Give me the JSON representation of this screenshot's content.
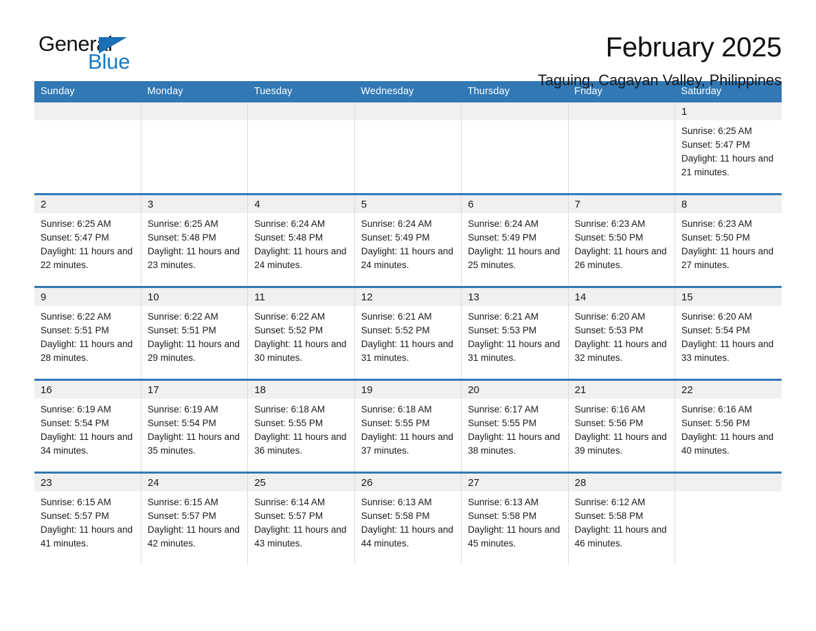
{
  "brand": {
    "word_one": "General",
    "word_two": "Blue",
    "triangle_icon": "triangle-icon",
    "accent_color": "#1a7bc4"
  },
  "header": {
    "title": "February 2025",
    "subtitle": "Taguing, Cagayan Valley, Philippines"
  },
  "theme": {
    "header_bar": "#3178b5",
    "date_band": "#f0f0f0",
    "cell_bg": "#ffffff",
    "text": "#1a1a1a"
  },
  "weekday_headers": [
    "Sunday",
    "Monday",
    "Tuesday",
    "Wednesday",
    "Thursday",
    "Friday",
    "Saturday"
  ],
  "weeks": [
    [
      {
        "day": "",
        "sunrise": "",
        "sunset": "",
        "daylight": "",
        "blank": true
      },
      {
        "day": "",
        "sunrise": "",
        "sunset": "",
        "daylight": "",
        "blank": true
      },
      {
        "day": "",
        "sunrise": "",
        "sunset": "",
        "daylight": "",
        "blank": true
      },
      {
        "day": "",
        "sunrise": "",
        "sunset": "",
        "daylight": "",
        "blank": true
      },
      {
        "day": "",
        "sunrise": "",
        "sunset": "",
        "daylight": "",
        "blank": true
      },
      {
        "day": "",
        "sunrise": "",
        "sunset": "",
        "daylight": "",
        "blank": true
      },
      {
        "day": "1",
        "sunrise": "Sunrise: 6:25 AM",
        "sunset": "Sunset: 5:47 PM",
        "daylight": "Daylight: 11 hours and 21 minutes.",
        "blank": false
      }
    ],
    [
      {
        "day": "2",
        "sunrise": "Sunrise: 6:25 AM",
        "sunset": "Sunset: 5:47 PM",
        "daylight": "Daylight: 11 hours and 22 minutes.",
        "blank": false
      },
      {
        "day": "3",
        "sunrise": "Sunrise: 6:25 AM",
        "sunset": "Sunset: 5:48 PM",
        "daylight": "Daylight: 11 hours and 23 minutes.",
        "blank": false
      },
      {
        "day": "4",
        "sunrise": "Sunrise: 6:24 AM",
        "sunset": "Sunset: 5:48 PM",
        "daylight": "Daylight: 11 hours and 24 minutes.",
        "blank": false
      },
      {
        "day": "5",
        "sunrise": "Sunrise: 6:24 AM",
        "sunset": "Sunset: 5:49 PM",
        "daylight": "Daylight: 11 hours and 24 minutes.",
        "blank": false
      },
      {
        "day": "6",
        "sunrise": "Sunrise: 6:24 AM",
        "sunset": "Sunset: 5:49 PM",
        "daylight": "Daylight: 11 hours and 25 minutes.",
        "blank": false
      },
      {
        "day": "7",
        "sunrise": "Sunrise: 6:23 AM",
        "sunset": "Sunset: 5:50 PM",
        "daylight": "Daylight: 11 hours and 26 minutes.",
        "blank": false
      },
      {
        "day": "8",
        "sunrise": "Sunrise: 6:23 AM",
        "sunset": "Sunset: 5:50 PM",
        "daylight": "Daylight: 11 hours and 27 minutes.",
        "blank": false
      }
    ],
    [
      {
        "day": "9",
        "sunrise": "Sunrise: 6:22 AM",
        "sunset": "Sunset: 5:51 PM",
        "daylight": "Daylight: 11 hours and 28 minutes.",
        "blank": false
      },
      {
        "day": "10",
        "sunrise": "Sunrise: 6:22 AM",
        "sunset": "Sunset: 5:51 PM",
        "daylight": "Daylight: 11 hours and 29 minutes.",
        "blank": false
      },
      {
        "day": "11",
        "sunrise": "Sunrise: 6:22 AM",
        "sunset": "Sunset: 5:52 PM",
        "daylight": "Daylight: 11 hours and 30 minutes.",
        "blank": false
      },
      {
        "day": "12",
        "sunrise": "Sunrise: 6:21 AM",
        "sunset": "Sunset: 5:52 PM",
        "daylight": "Daylight: 11 hours and 31 minutes.",
        "blank": false
      },
      {
        "day": "13",
        "sunrise": "Sunrise: 6:21 AM",
        "sunset": "Sunset: 5:53 PM",
        "daylight": "Daylight: 11 hours and 31 minutes.",
        "blank": false
      },
      {
        "day": "14",
        "sunrise": "Sunrise: 6:20 AM",
        "sunset": "Sunset: 5:53 PM",
        "daylight": "Daylight: 11 hours and 32 minutes.",
        "blank": false
      },
      {
        "day": "15",
        "sunrise": "Sunrise: 6:20 AM",
        "sunset": "Sunset: 5:54 PM",
        "daylight": "Daylight: 11 hours and 33 minutes.",
        "blank": false
      }
    ],
    [
      {
        "day": "16",
        "sunrise": "Sunrise: 6:19 AM",
        "sunset": "Sunset: 5:54 PM",
        "daylight": "Daylight: 11 hours and 34 minutes.",
        "blank": false
      },
      {
        "day": "17",
        "sunrise": "Sunrise: 6:19 AM",
        "sunset": "Sunset: 5:54 PM",
        "daylight": "Daylight: 11 hours and 35 minutes.",
        "blank": false
      },
      {
        "day": "18",
        "sunrise": "Sunrise: 6:18 AM",
        "sunset": "Sunset: 5:55 PM",
        "daylight": "Daylight: 11 hours and 36 minutes.",
        "blank": false
      },
      {
        "day": "19",
        "sunrise": "Sunrise: 6:18 AM",
        "sunset": "Sunset: 5:55 PM",
        "daylight": "Daylight: 11 hours and 37 minutes.",
        "blank": false
      },
      {
        "day": "20",
        "sunrise": "Sunrise: 6:17 AM",
        "sunset": "Sunset: 5:55 PM",
        "daylight": "Daylight: 11 hours and 38 minutes.",
        "blank": false
      },
      {
        "day": "21",
        "sunrise": "Sunrise: 6:16 AM",
        "sunset": "Sunset: 5:56 PM",
        "daylight": "Daylight: 11 hours and 39 minutes.",
        "blank": false
      },
      {
        "day": "22",
        "sunrise": "Sunrise: 6:16 AM",
        "sunset": "Sunset: 5:56 PM",
        "daylight": "Daylight: 11 hours and 40 minutes.",
        "blank": false
      }
    ],
    [
      {
        "day": "23",
        "sunrise": "Sunrise: 6:15 AM",
        "sunset": "Sunset: 5:57 PM",
        "daylight": "Daylight: 11 hours and 41 minutes.",
        "blank": false
      },
      {
        "day": "24",
        "sunrise": "Sunrise: 6:15 AM",
        "sunset": "Sunset: 5:57 PM",
        "daylight": "Daylight: 11 hours and 42 minutes.",
        "blank": false
      },
      {
        "day": "25",
        "sunrise": "Sunrise: 6:14 AM",
        "sunset": "Sunset: 5:57 PM",
        "daylight": "Daylight: 11 hours and 43 minutes.",
        "blank": false
      },
      {
        "day": "26",
        "sunrise": "Sunrise: 6:13 AM",
        "sunset": "Sunset: 5:58 PM",
        "daylight": "Daylight: 11 hours and 44 minutes.",
        "blank": false
      },
      {
        "day": "27",
        "sunrise": "Sunrise: 6:13 AM",
        "sunset": "Sunset: 5:58 PM",
        "daylight": "Daylight: 11 hours and 45 minutes.",
        "blank": false
      },
      {
        "day": "28",
        "sunrise": "Sunrise: 6:12 AM",
        "sunset": "Sunset: 5:58 PM",
        "daylight": "Daylight: 11 hours and 46 minutes.",
        "blank": false
      },
      {
        "day": "",
        "sunrise": "",
        "sunset": "",
        "daylight": "",
        "blank": true
      }
    ]
  ]
}
